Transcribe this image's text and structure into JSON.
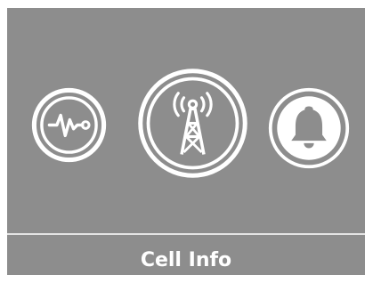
{
  "screen": {
    "background_color": "#8d8d8d",
    "foreground_color": "#ffffff",
    "caption": "Cell Info",
    "icons": [
      {
        "name": "signal-waveform-icon",
        "selected": false
      },
      {
        "name": "cell-tower-icon",
        "selected": true
      },
      {
        "name": "bell-icon",
        "selected": false
      }
    ]
  }
}
